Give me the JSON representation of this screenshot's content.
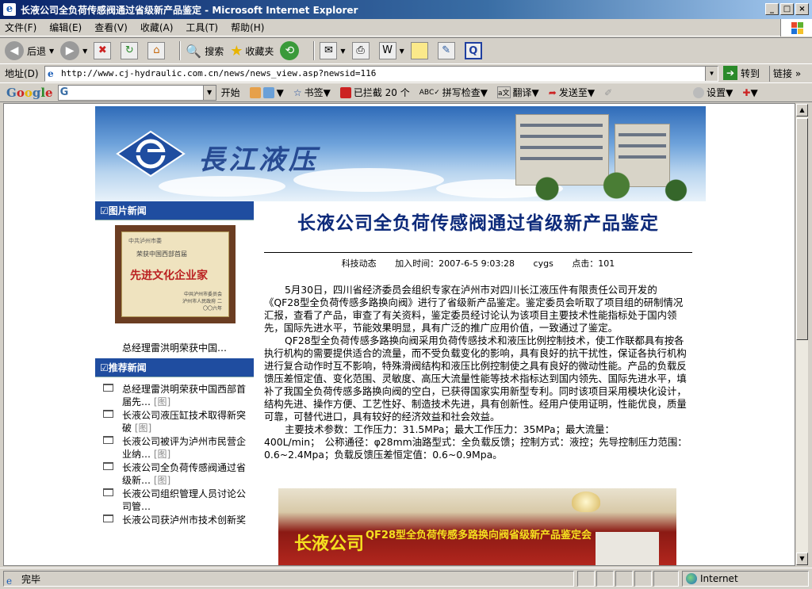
{
  "window": {
    "title": "长液公司全负荷传感阀通过省级新产品鉴定 - Microsoft Internet Explorer",
    "controls": [
      "_",
      "□",
      "×"
    ]
  },
  "menu": [
    "文件(F)",
    "编辑(E)",
    "查看(V)",
    "收藏(A)",
    "工具(T)",
    "帮助(H)"
  ],
  "toolbar": {
    "back": "后退",
    "search": "搜索",
    "favorites": "收藏夹"
  },
  "address": {
    "label": "地址(D)",
    "url": "http://www.cj-hydraulic.com.cn/news/news_view.asp?newsid=116",
    "go": "转到",
    "links": "链接"
  },
  "googlebar": {
    "logo": "Google",
    "search_prefix": "G",
    "start": "开始",
    "bookmarks": "书签",
    "blocked": "已拦截 20 个",
    "spellcheck": "拼写检查",
    "translate": "翻译",
    "sendto": "发送至",
    "settings": "设置"
  },
  "banner": {
    "brand": "長江液压"
  },
  "sidebar": {
    "pic_news_title": "☑图片新闻",
    "plaque": {
      "line1": "中共泸州市委",
      "line2": "荣获中国西部首届",
      "line3": "先进文化企业家",
      "line4": "中共泸州市委员会 泸州市人民政府 二〇〇六年"
    },
    "pic_caption": "总经理雷洪明荣获中国…",
    "rec_title": "☑推荐新闻",
    "rec_tag": "[图]",
    "rec_items": [
      "总经理雷洪明荣获中国西部首届先…",
      "长液公司液压缸技术取得新突破",
      "长液公司被评为泸州市民营企业纳…",
      "长液公司全负荷传感阀通过省级新…",
      "长液公司组织管理人员讨论公司管…",
      "长液公司获泸州市技术创新奖"
    ]
  },
  "article": {
    "title": "长液公司全负荷传感阀通过省级新产品鉴定",
    "category": "科技动态",
    "time_label": "加入时间：2007-6-5 9:03:28",
    "author": "cygs",
    "hits": "点击：101",
    "para1": "5月30日，四川省经济委员会组织专家在泸州市对四川长江液压件有限责任公司开发的《QF28型全负荷传感多路换向阀》进行了省级新产品鉴定。鉴定委员会听取了项目组的研制情况汇报，查看了产品，审查了有关资料，鉴定委员经讨论认为该项目主要技术性能指标处于国内领先，国际先进水平，节能效果明显，具有广泛的推广应用价值，一致通过了鉴定。",
    "para2": "QF28型全负荷传感多路换向阀采用负荷传感技术和液压比例控制技术，使工作联都具有按各执行机构的需要提供适合的流量，而不受负载变化的影响，具有良好的抗干扰性，保证各执行机构进行复合动作时互不影响，特殊滑阀结构和液压比例控制使之具有良好的微动性能。产品的负载反馈压差恒定值、变化范围、灵敏度、高压大流量性能等技术指标达到国内领先、国际先进水平，填补了我国全负荷传感多路换向阀的空白，已获得国家实用新型专利。同时该项目采用模块化设计，结构先进、操作方便、工艺性好、制造技术先进，具有创新性。经用户使用证明，性能优良，质量可靠，可替代进口，具有较好的经济效益和社会效益。",
    "para3": "主要技术参数：工作压力：31.5MPa；最大工作压力：35MPa；最大流量：",
    "para3b": "400L/min；　公称通径：φ28mm油路型式：全负载反馈；控制方式：液控；先导控制压力范围：0.6~2.4Mpa；负载反馈压差恒定值：0.6~0.9Mpa。",
    "photo_banner": "长液公司",
    "photo_banner2": "QF28型全负荷传感多路换向阀省级新产品鉴定会"
  },
  "status": {
    "text": "完毕",
    "zone": "Internet"
  }
}
